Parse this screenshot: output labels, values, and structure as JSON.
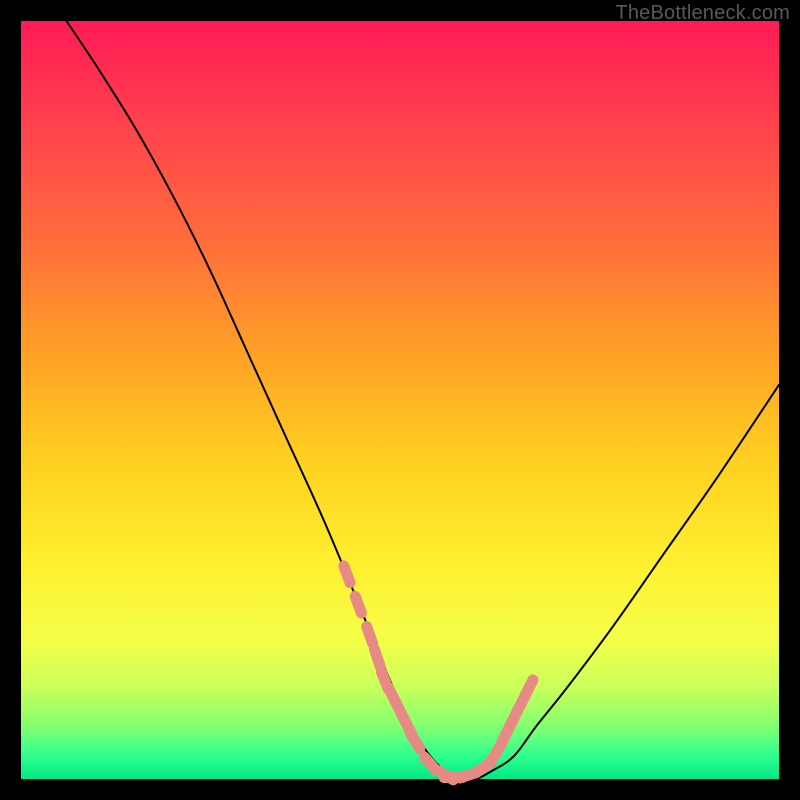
{
  "watermark": "TheBottleneck.com",
  "chart_data": {
    "type": "line",
    "title": "",
    "xlabel": "",
    "ylabel": "",
    "xlim": [
      0,
      100
    ],
    "ylim": [
      0,
      100
    ],
    "grid": false,
    "legend": false,
    "description": "V-shaped bottleneck curve with minimum near x≈57, rendered over a red→yellow→green vertical gradient background. Salmon dots mark sampled points along the curve.",
    "series": [
      {
        "name": "bottleneck_curve",
        "x": [
          6,
          10,
          15,
          20,
          25,
          30,
          35,
          40,
          45,
          47,
          50,
          52,
          54,
          56,
          58,
          60,
          62,
          65,
          68,
          72,
          78,
          85,
          92,
          100
        ],
        "y": [
          100,
          94,
          86,
          77,
          67,
          56,
          45,
          34,
          22,
          17,
          10,
          6,
          3,
          1,
          0,
          0,
          1,
          3,
          7,
          12,
          20,
          30,
          40,
          52
        ]
      },
      {
        "name": "sample_dots",
        "x": [
          43,
          44.5,
          46,
          47,
          48,
          49,
          50,
          51,
          52,
          54,
          56,
          57,
          59,
          61,
          62,
          63,
          64,
          65,
          66,
          67
        ],
        "y": [
          27,
          23,
          19,
          16,
          13,
          11,
          9,
          7,
          5,
          2,
          0.5,
          0.2,
          0.5,
          1.5,
          2.5,
          4,
          6,
          8,
          10,
          12
        ]
      }
    ]
  }
}
